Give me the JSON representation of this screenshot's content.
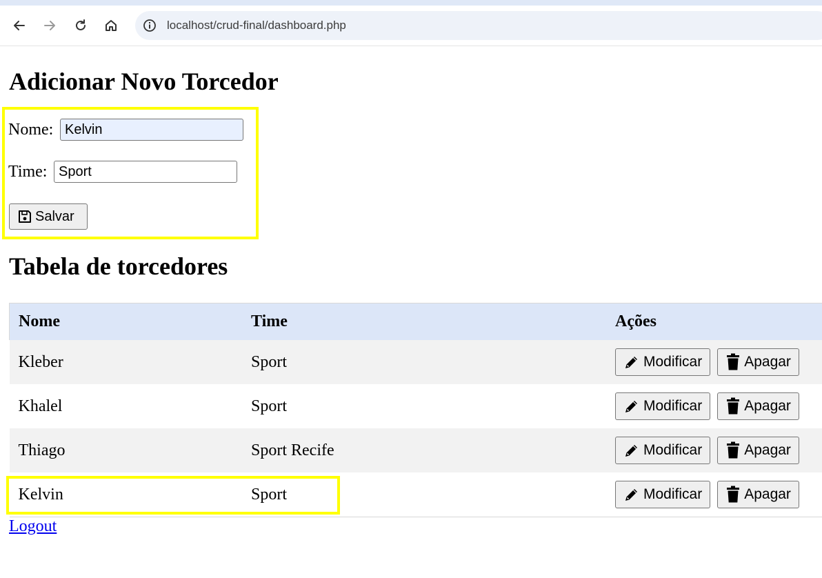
{
  "browser": {
    "url": "localhost/crud-final/dashboard.php"
  },
  "form": {
    "title": "Adicionar Novo Torcedor",
    "nome_label": "Nome:",
    "nome_value": "Kelvin",
    "time_label": "Time:",
    "time_value": "Sport",
    "save_label": "Salvar"
  },
  "table": {
    "title": "Tabela de torcedores",
    "headers": [
      "Nome",
      "Time",
      "Ações"
    ],
    "rows": [
      {
        "nome": "Kleber",
        "time": "Sport"
      },
      {
        "nome": "Khalel",
        "time": "Sport"
      },
      {
        "nome": "Thiago",
        "time": "Sport Recife"
      },
      {
        "nome": "Kelvin",
        "time": "Sport"
      }
    ],
    "edit_label": "Modificar",
    "delete_label": "Apagar"
  },
  "logout_label": "Logout",
  "colors": {
    "highlight": "#ffff00",
    "header_bg": "#dce6f8",
    "link": "#0000ee"
  },
  "icons": [
    "back-arrow-icon",
    "forward-arrow-icon",
    "reload-icon",
    "home-icon",
    "info-icon",
    "floppy-disk-icon",
    "pencil-icon",
    "trash-icon"
  ]
}
